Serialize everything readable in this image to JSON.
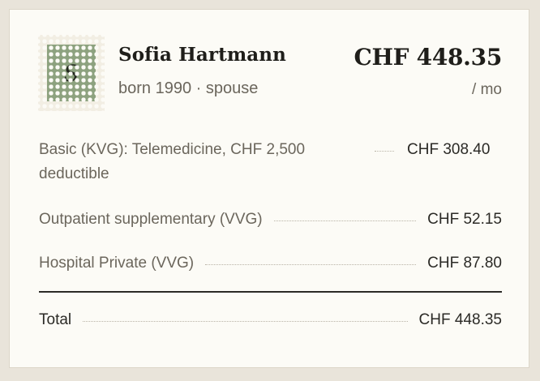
{
  "person": {
    "initial": "S",
    "name": "Sofia Hartmann",
    "subtitle": "born 1990 · spouse"
  },
  "premium": {
    "amount": "CHF 448.35",
    "period": "/ mo"
  },
  "items": [
    {
      "label": "Basic (KVG): Telemedicine, CHF 2,500 deductible",
      "amount": "CHF 308.40"
    },
    {
      "label": "Outpatient supplementary (VVG)",
      "amount": "CHF 52.15"
    },
    {
      "label": "Hospital Private (VVG)",
      "amount": "CHF 87.80"
    }
  ],
  "total": {
    "label": "Total",
    "amount": "CHF 448.35"
  },
  "colors": {
    "avatar": "#8da27f",
    "card": "#fcfbf6",
    "background": "#e9e4da"
  }
}
